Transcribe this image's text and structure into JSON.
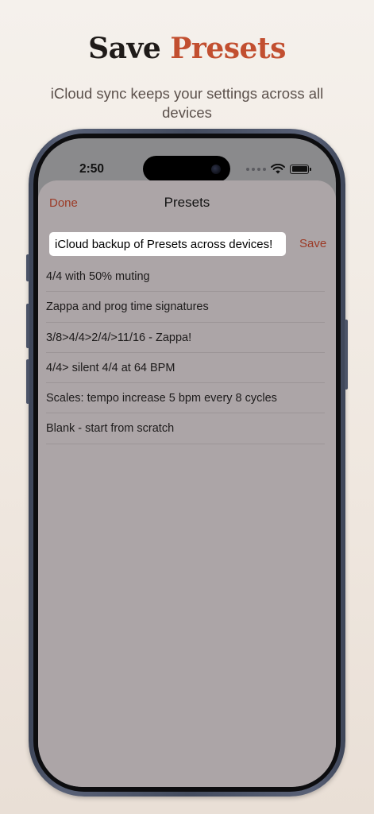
{
  "headline": {
    "word1": "Save",
    "word2": "Presets"
  },
  "subhead": "iCloud sync keeps your settings across all devices",
  "status": {
    "time": "2:50",
    "wifi_icon": "wifi-icon",
    "battery_icon": "battery-icon",
    "battery_level": 1.0
  },
  "sheet": {
    "done_label": "Done",
    "title": "Presets",
    "input_value": "iCloud backup of Presets across devices!",
    "save_label": "Save",
    "presets": [
      "4/4 with 50% muting",
      "Zappa and prog time signatures",
      "3/8>4/4>2/4/>11/16 - Zappa!",
      "4/4> silent 4/4 at 64 BPM",
      "Scales: tempo increase 5 bpm every 8 cycles",
      "Blank - start from scratch"
    ]
  },
  "colors": {
    "accent": "#9c3a26",
    "headline_accent": "#c24f30",
    "sheet_background": "#aca5a7",
    "page_background": "#f5f1ec"
  }
}
